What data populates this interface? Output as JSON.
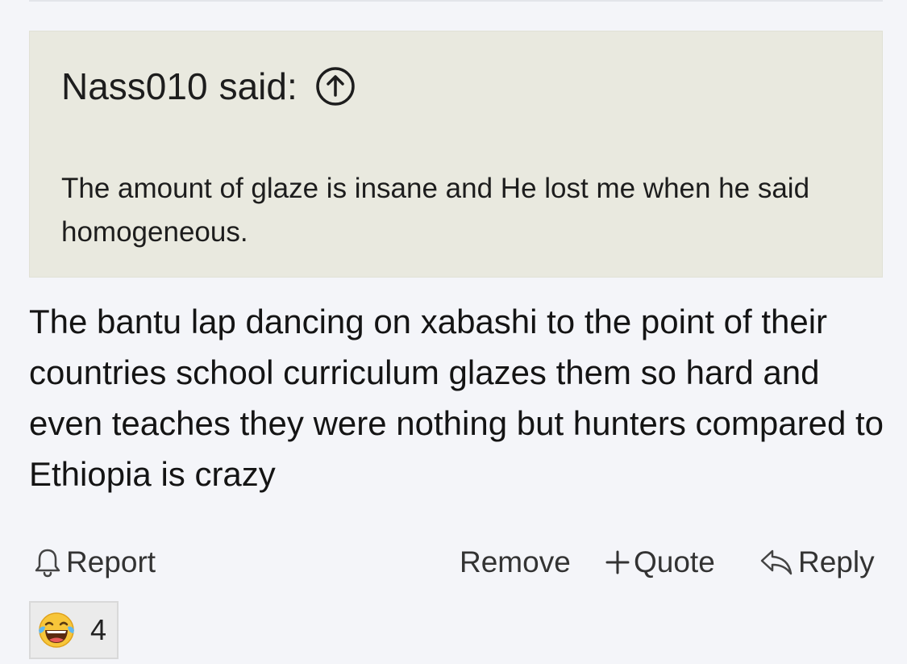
{
  "quote": {
    "author": "Nass010",
    "said_label": "said:",
    "text": "The amount of glaze is insane and He lost me when he said homogeneous."
  },
  "post": {
    "body": "The bantu lap dancing on xabashi to the point of their countries school curriculum glazes them so hard and even teaches they were nothing but hunters compared to Ethiopia is crazy"
  },
  "actions": {
    "report": "Report",
    "remove": "Remove",
    "quote": "Quote",
    "reply": "Reply"
  },
  "reactions": {
    "emoji": "laughing-with-tears-emoji",
    "count": "4"
  },
  "icons": {
    "jump_to_quote": "arrow-up-circle-icon",
    "report": "bell-icon",
    "quote": "plus-icon",
    "reply": "reply-arrow-icon"
  }
}
